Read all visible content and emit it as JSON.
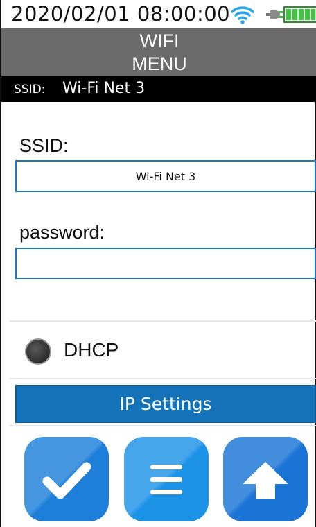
{
  "status_bar": {
    "datetime": "2020/02/01 08:00:00",
    "icons": [
      "wifi-icon",
      "plug-icon",
      "battery-icon"
    ],
    "battery_level": 1.0
  },
  "header": {
    "title_line1": "WIFI",
    "title_line2": "MENU"
  },
  "ssid_strip": {
    "label": "SSID:",
    "value": "Wi-Fi Net 3"
  },
  "form": {
    "ssid_label": "SSID:",
    "ssid_value": "Wi-Fi Net 3",
    "password_label": "password:",
    "password_value": ""
  },
  "dhcp": {
    "label": "DHCP",
    "selected": false
  },
  "ip_settings_label": "IP Settings",
  "bottom_buttons": [
    {
      "icon": "checkmark-icon"
    },
    {
      "icon": "menu-icon"
    },
    {
      "icon": "upload-arrow-icon"
    }
  ],
  "colors": {
    "titlebar": "#6b6b6b",
    "accent": "#1472b8",
    "battery": "#3ec43e"
  }
}
